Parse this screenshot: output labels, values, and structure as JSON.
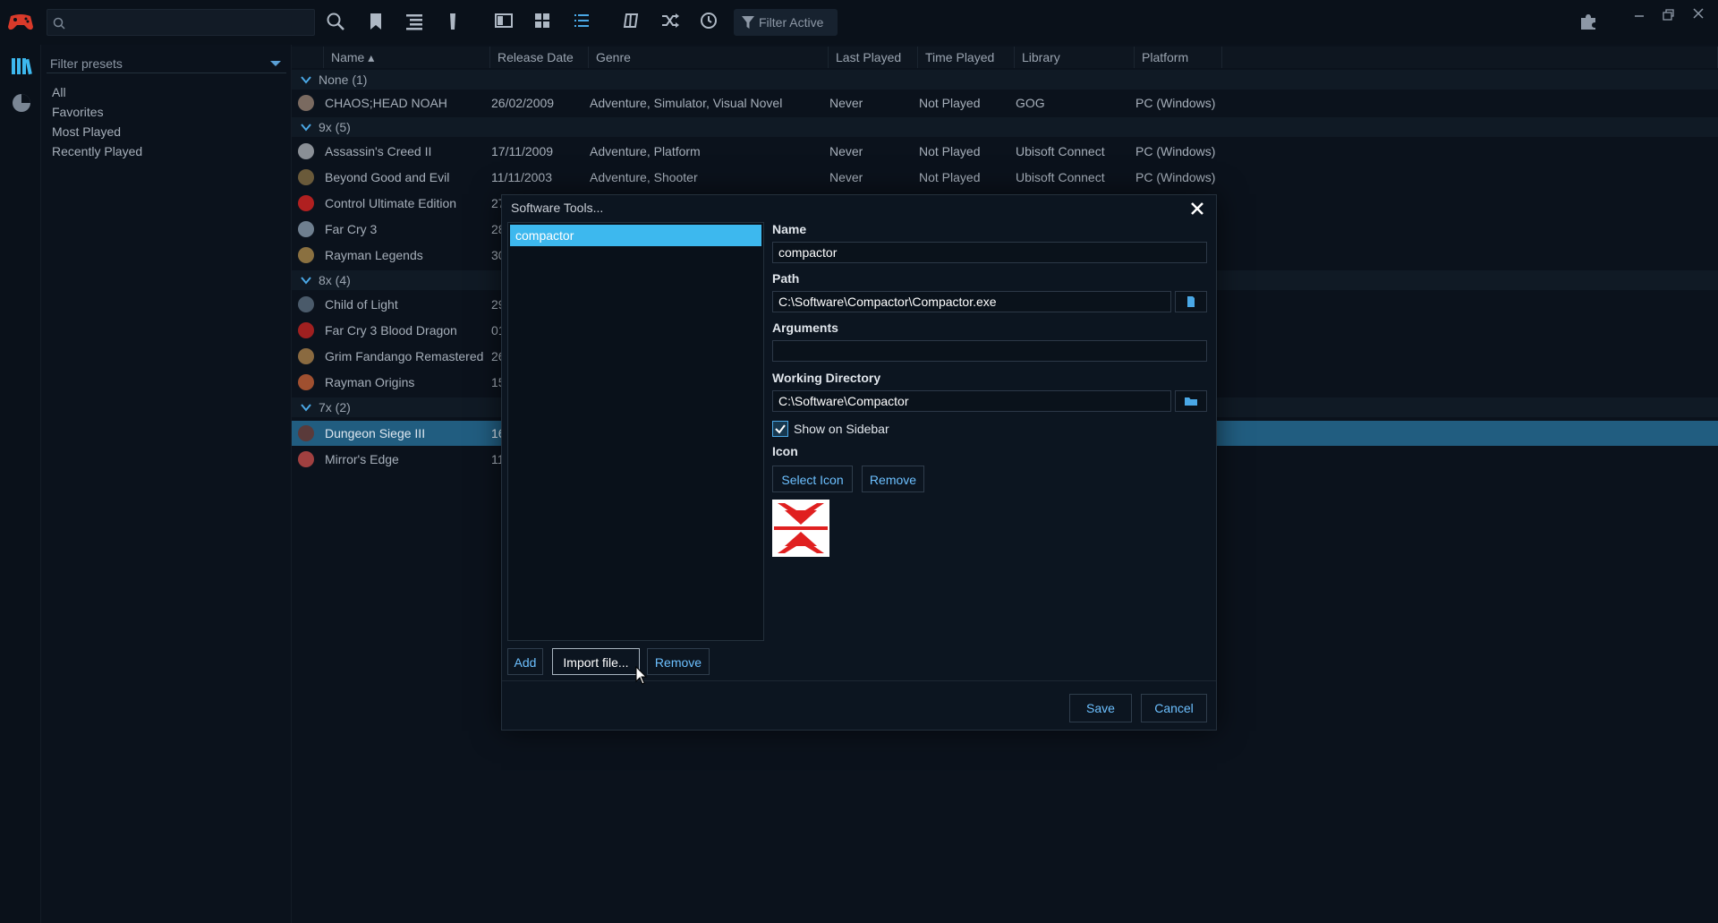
{
  "app": {
    "filter_active": "Filter Active"
  },
  "filter_panel": {
    "presets_placeholder": "Filter presets",
    "items": [
      "All",
      "Favorites",
      "Most Played",
      "Recently Played"
    ]
  },
  "table": {
    "columns": [
      "Name ▴",
      "Release Date",
      "Genre",
      "Last Played",
      "Time Played",
      "Library",
      "Platform"
    ],
    "groups": [
      {
        "label": "None (1)"
      },
      {
        "label": "9x (5)"
      },
      {
        "label": "8x (4)"
      },
      {
        "label": "7x (2)"
      }
    ],
    "rows": [
      {
        "name": "CHAOS;HEAD NOAH",
        "release": "26/02/2009",
        "genre": "Adventure, Simulator, Visual Novel",
        "last": "Never",
        "time": "Not Played",
        "library": "GOG",
        "platform": "PC (Windows)",
        "icon_color": "#7a6a60"
      },
      {
        "name": "Assassin's Creed II",
        "release": "17/11/2009",
        "genre": "Adventure, Platform",
        "last": "Never",
        "time": "Not Played",
        "library": "Ubisoft Connect",
        "platform": "PC (Windows)",
        "icon_color": "#8a8f96"
      },
      {
        "name": "Beyond Good and Evil",
        "release": "11/11/2003",
        "genre": "Adventure, Shooter",
        "last": "Never",
        "time": "Not Played",
        "library": "Ubisoft Connect",
        "platform": "PC (Windows)",
        "icon_color": "#6a5a3a"
      },
      {
        "name": "Control Ultimate Edition",
        "release": "27",
        "genre": "",
        "last": "",
        "time": "",
        "library": "",
        "platform": "",
        "icon_color": "#b02020"
      },
      {
        "name": "Far Cry 3",
        "release": "28",
        "genre": "",
        "last": "",
        "time": "",
        "library": "",
        "platform": "",
        "icon_color": "#6f7f8f"
      },
      {
        "name": "Rayman Legends",
        "release": "30",
        "genre": "",
        "last": "",
        "time": "",
        "library": "",
        "platform": "",
        "icon_color": "#8a7040"
      },
      {
        "name": "Child of Light",
        "release": "29",
        "genre": "",
        "last": "",
        "time": "",
        "library": "",
        "platform": "",
        "icon_color": "#4a5a6a"
      },
      {
        "name": "Far Cry 3 Blood Dragon",
        "release": "01",
        "genre": "",
        "last": "",
        "time": "",
        "library": "",
        "platform": "",
        "icon_color": "#a02020"
      },
      {
        "name": "Grim Fandango Remastered",
        "release": "26",
        "genre": "",
        "last": "",
        "time": "",
        "library": "",
        "platform": "",
        "icon_color": "#8a6a40"
      },
      {
        "name": "Rayman Origins",
        "release": "15",
        "genre": "",
        "last": "",
        "time": "",
        "library": "",
        "platform": "",
        "icon_color": "#a05030"
      },
      {
        "name": "Dungeon Siege III",
        "release": "16",
        "genre": "",
        "last": "",
        "time": "",
        "library": "",
        "platform": "",
        "icon_color": "#5a3a3a"
      },
      {
        "name": "Mirror's Edge",
        "release": "11",
        "genre": "",
        "last": "",
        "time": "",
        "library": "",
        "platform": "",
        "icon_color": "#a04040"
      }
    ]
  },
  "dialog": {
    "title": "Software Tools...",
    "tools": [
      "compactor"
    ],
    "add_label": "Add",
    "import_label": "Import file...",
    "remove_label": "Remove",
    "name_label": "Name",
    "name_value": "compactor",
    "path_label": "Path",
    "path_value": "C:\\Software\\Compactor\\Compactor.exe",
    "arguments_label": "Arguments",
    "arguments_value": "",
    "workdir_label": "Working Directory",
    "workdir_value": "C:\\Software\\Compactor",
    "show_sidebar_label": "Show on Sidebar",
    "show_sidebar_checked": true,
    "icon_label": "Icon",
    "select_icon_label": "Select Icon",
    "icon_remove_label": "Remove",
    "save_label": "Save",
    "cancel_label": "Cancel"
  },
  "colors": {
    "accent": "#3db8ee",
    "selected_row": "#215d80",
    "button_text": "#6cc0ff",
    "icon_red": "#e02020"
  }
}
